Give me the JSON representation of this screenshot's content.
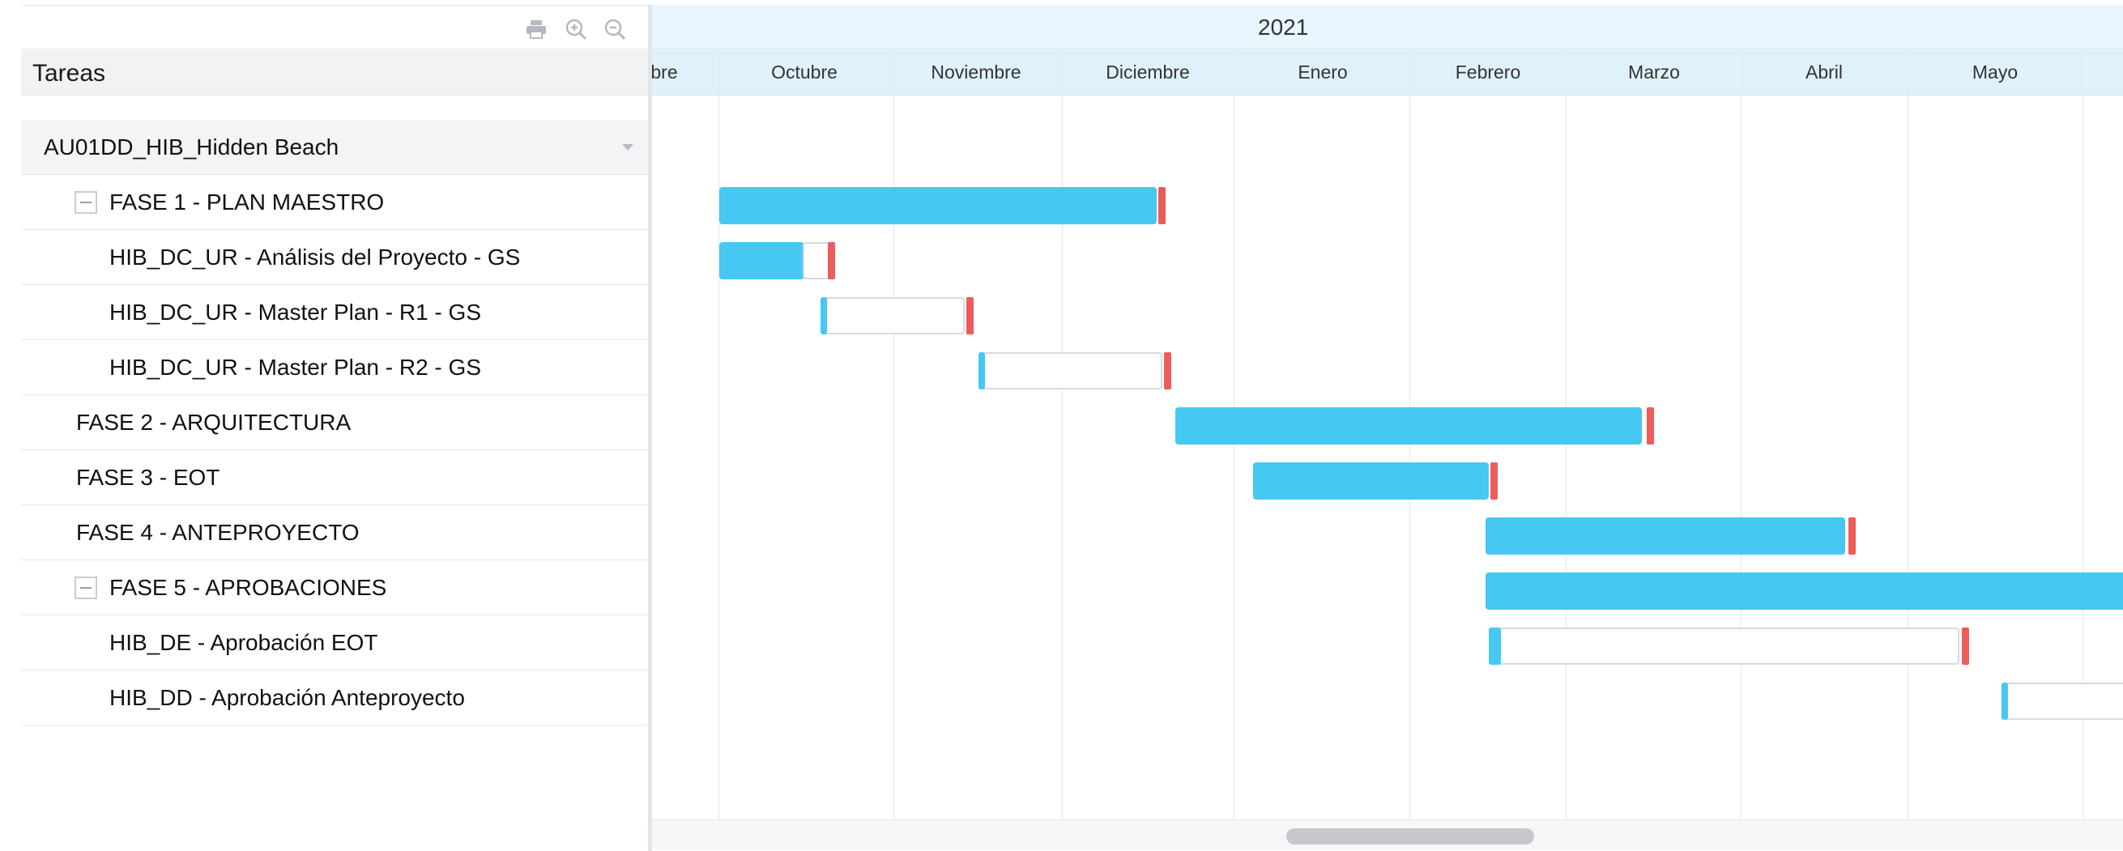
{
  "toolbar": {
    "icons": [
      "print-icon",
      "zoom-in-icon",
      "zoom-out-icon"
    ]
  },
  "tasks_panel": {
    "header": "Tareas",
    "rows": [
      {
        "label": "AU01DD_HIB_Hidden Beach",
        "level": 0,
        "type": "project"
      },
      {
        "label": "FASE 1 - PLAN MAESTRO",
        "level": 1,
        "collapsible": true
      },
      {
        "label": "HIB_DC_UR - Análisis del Proyecto - GS",
        "level": 2
      },
      {
        "label": "HIB_DC_UR - Master Plan - R1 - GS",
        "level": 2
      },
      {
        "label": "HIB_DC_UR - Master Plan - R2 - GS",
        "level": 2
      },
      {
        "label": "FASE 2 - ARQUITECTURA",
        "level": 1
      },
      {
        "label": "FASE 3 - EOT",
        "level": 1
      },
      {
        "label": "FASE 4 - ANTEPROYECTO",
        "level": 1
      },
      {
        "label": "FASE 5 - APROBACIONES",
        "level": 1,
        "collapsible": true
      },
      {
        "label": "HIB_DE - Aprobación EOT",
        "level": 2
      },
      {
        "label": "HIB_DD - Aprobación Anteproyecto",
        "level": 2
      }
    ]
  },
  "timeline": {
    "year": "2021",
    "months": [
      "bre",
      "Octubre",
      "Noviembre",
      "Diciembre",
      "Enero",
      "Febrero",
      "Marzo",
      "Abril",
      "Mayo"
    ]
  },
  "colors": {
    "bar": "#47c8f3",
    "deadline": "#ee5b5b",
    "header_band": "#dff2fc"
  }
}
